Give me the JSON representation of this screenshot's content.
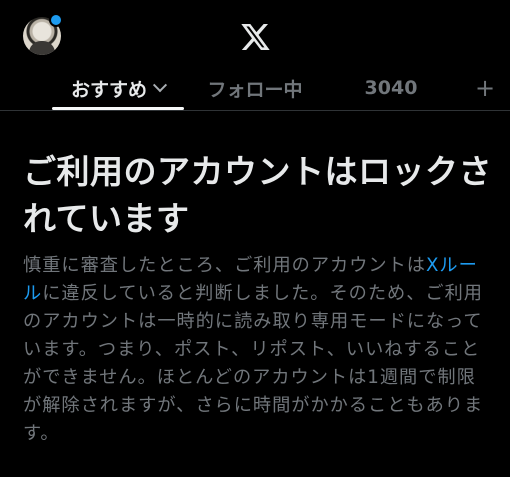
{
  "header": {
    "logo_icon": "x-logo-icon",
    "avatar_icon": "profile-avatar",
    "notification_dot_color": "#1d9bf0"
  },
  "tabs": [
    {
      "label": "おすすめ",
      "active": true,
      "has_dropdown": true
    },
    {
      "label": "フォロー中",
      "active": false
    },
    {
      "label": "3040",
      "active": false
    }
  ],
  "add_tab": {
    "label": "+"
  },
  "notice": {
    "title": "ご利用のアカウントはロックされています",
    "body_before_link": "慎重に審査したところ、ご利用のアカウントは",
    "link_text": "Xルール",
    "body_after_link": "に違反していると判断しました。そのため、ご利用のアカウントは一時的に読み取り専用モードになっています。つまり、ポスト、リポスト、いいねすることができません。ほとんどのアカウントは1週間で制限が解除されますが、さらに時間がかかることもあります。"
  },
  "colors": {
    "background": "#000000",
    "text_primary": "#e7e9ea",
    "text_secondary": "#71767b",
    "link": "#1d9bf0",
    "divider": "#2f3336"
  }
}
